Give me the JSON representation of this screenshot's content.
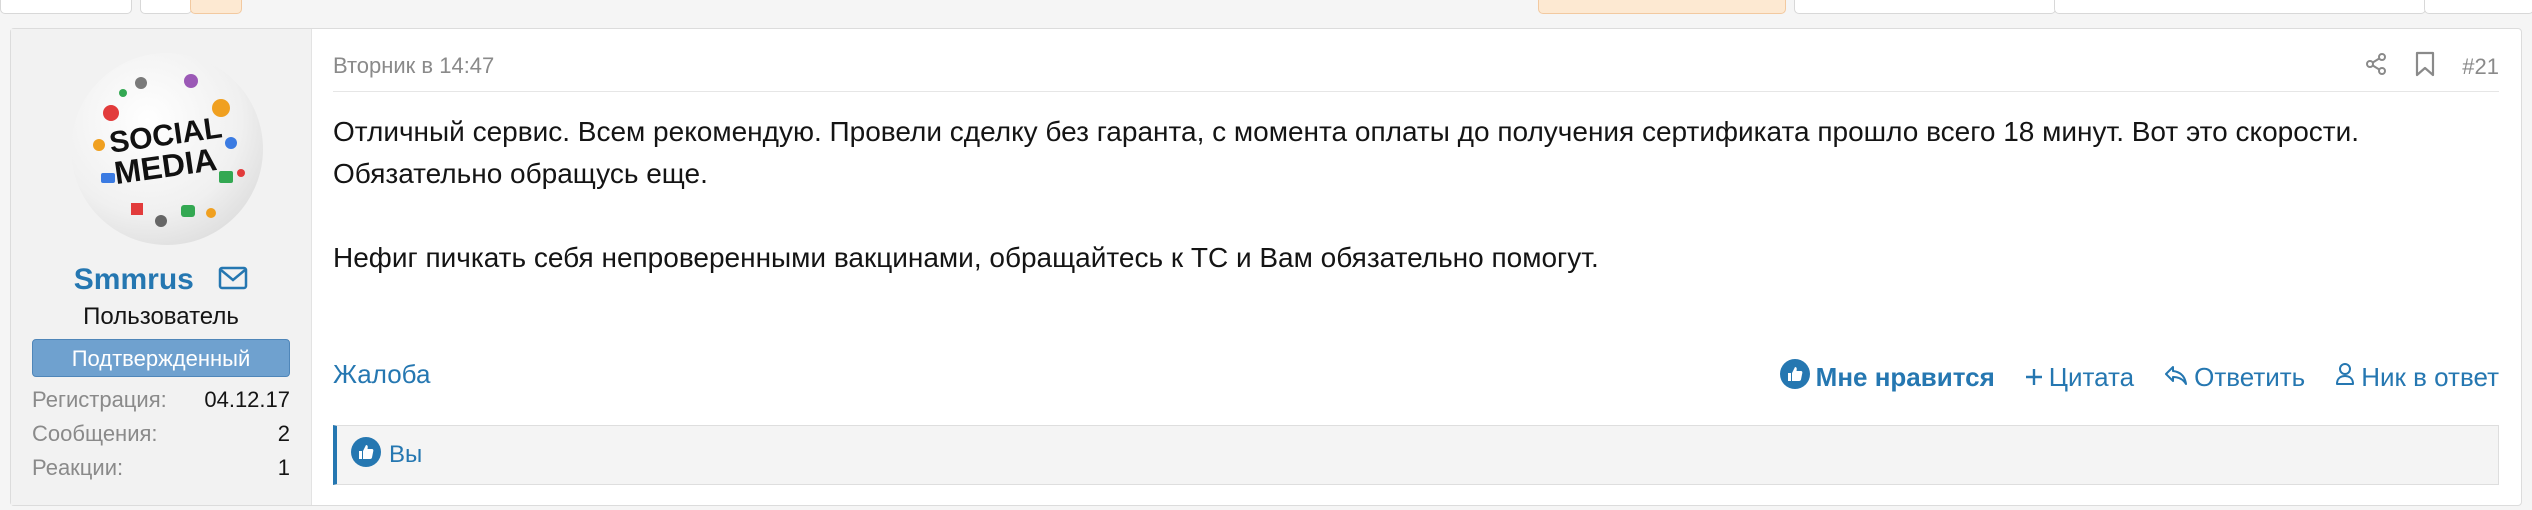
{
  "post": {
    "date": "Вторник в 14:47",
    "number": "#21",
    "paragraph1": "Отличный сервис. Всем рекомендую. Провели сделку без гаранта, с момента оплаты до получения сертификата прошло всего 18 минут. Вот это скорости. Обязательно обращусь еще.",
    "paragraph2": "Нефиг пичкать себя непроверенными вакцинами, обращайтесь к ТС и Вам обязательно помогут.",
    "report": "Жалоба",
    "actions": {
      "like": "Мне нравится",
      "quote": "Цитата",
      "reply": "Ответить",
      "mention": "Ник в ответ"
    },
    "likes_by": "Вы"
  },
  "user": {
    "name": "Smmrus",
    "role": "Пользователь",
    "badge": "Подтвержденный",
    "avatar_text": [
      "SOCIAL",
      "MEDIA"
    ],
    "stats": [
      {
        "label": "Регистрация:",
        "value": "04.12.17"
      },
      {
        "label": "Сообщения:",
        "value": "2"
      },
      {
        "label": "Реакции:",
        "value": "1"
      }
    ]
  },
  "colors": {
    "accent": "#2577b1",
    "badge": "#6fa1cf",
    "muted": "#8a8a8a"
  },
  "icons": [
    "mail-icon",
    "share-icon",
    "bookmark-icon",
    "like-icon",
    "plus-icon",
    "reply-icon",
    "user-icon"
  ]
}
